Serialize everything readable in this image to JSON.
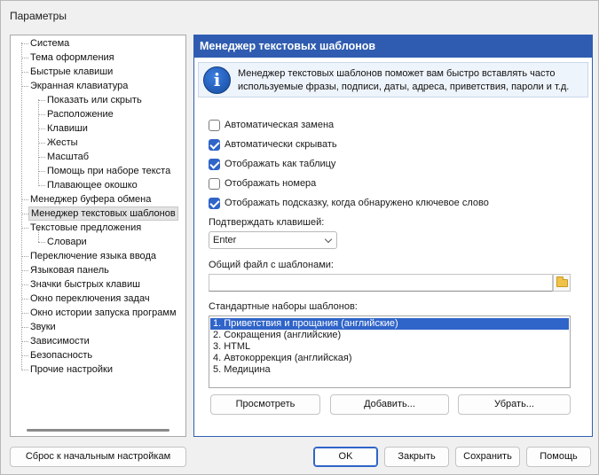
{
  "window": {
    "title": "Параметры"
  },
  "tree": {
    "items": [
      {
        "label": "Система"
      },
      {
        "label": "Тема оформления"
      },
      {
        "label": "Быстрые клавиши"
      },
      {
        "label": "Экранная клавиатура"
      },
      {
        "label": "Показать или скрыть"
      },
      {
        "label": "Расположение"
      },
      {
        "label": "Клавиши"
      },
      {
        "label": "Жесты"
      },
      {
        "label": "Масштаб"
      },
      {
        "label": "Помощь при наборе текста"
      },
      {
        "label": "Плавающее окошко"
      },
      {
        "label": "Менеджер буфера обмена"
      },
      {
        "label": "Менеджер текстовых шаблонов"
      },
      {
        "label": "Текстовые предложения"
      },
      {
        "label": "Словари"
      },
      {
        "label": "Переключение языка ввода"
      },
      {
        "label": "Языковая панель"
      },
      {
        "label": "Значки быстрых клавиш"
      },
      {
        "label": "Окно переключения задач"
      },
      {
        "label": "Окно истории запуска программ"
      },
      {
        "label": "Звуки"
      },
      {
        "label": "Зависимости"
      },
      {
        "label": "Безопасность"
      },
      {
        "label": "Прочие настройки"
      }
    ],
    "selected": "Менеджер текстовых шаблонов"
  },
  "panel": {
    "title": "Менеджер текстовых шаблонов",
    "info_line1": "Менеджер текстовых шаблонов поможет вам быстро вставлять часто",
    "info_line2": "используемые фразы, подписи, даты, адреса, приветствия, пароли и т.д.",
    "checkboxes": [
      {
        "label": "Автоматическая замена",
        "checked": false
      },
      {
        "label": "Автоматически скрывать",
        "checked": true
      },
      {
        "label": "Отображать как таблицу",
        "checked": true
      },
      {
        "label": "Отображать номера",
        "checked": false
      },
      {
        "label": "Отображать подсказку, когда обнаружено ключевое слово",
        "checked": true
      }
    ],
    "confirm_label": "Подтверждать клавишей:",
    "confirm_value": "Enter",
    "file_label": "Общий файл с шаблонами:",
    "file_value": "",
    "sets_label": "Стандартные наборы шаблонов:",
    "sets": [
      "1. Приветствия и прощания (английские)",
      "2. Сокращения (английские)",
      "3. HTML",
      "4. Автокоррекция (английская)",
      "5. Медицина"
    ],
    "buttons": {
      "view": "Просмотреть",
      "add": "Добавить...",
      "remove": "Убрать..."
    }
  },
  "footer": {
    "reset": "Сброс к начальным настройкам",
    "ok": "OK",
    "close": "Закрыть",
    "save": "Сохранить",
    "help": "Помощь"
  },
  "colors": {
    "accent": "#2f5cb0",
    "selection": "#2f64c8"
  }
}
